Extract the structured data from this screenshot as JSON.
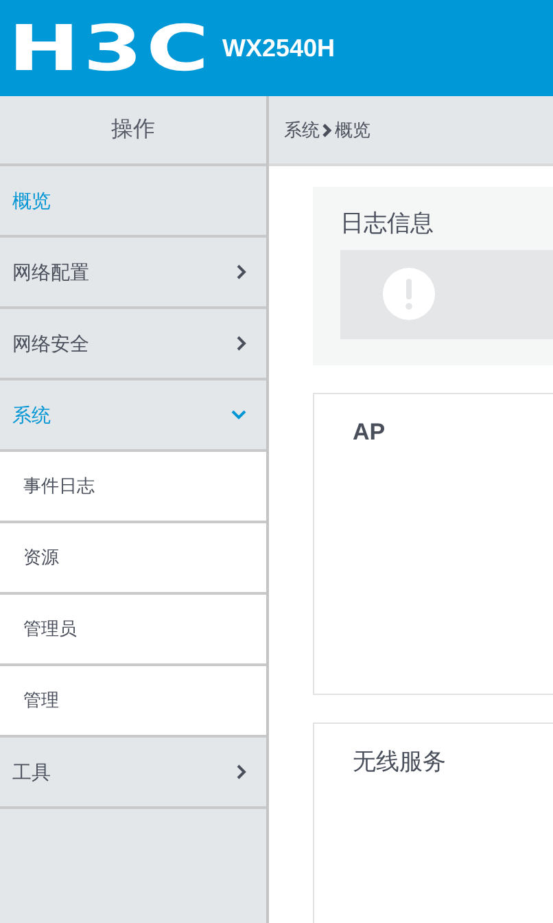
{
  "header": {
    "logo": "H3C",
    "model": "WX2540H"
  },
  "sidebar": {
    "title": "操作",
    "items": [
      {
        "kind": "link",
        "label": "概览",
        "selected": true
      },
      {
        "kind": "group",
        "label": "网络配置",
        "selected": false,
        "expanded": false
      },
      {
        "kind": "group",
        "label": "网络安全",
        "selected": false,
        "expanded": false
      },
      {
        "kind": "group",
        "label": "系统",
        "selected": true,
        "expanded": true,
        "children": [
          {
            "label": "事件日志",
            "selected": false
          },
          {
            "label": "资源",
            "selected": false
          },
          {
            "label": "管理员",
            "selected": false
          },
          {
            "label": "管理",
            "selected": false
          }
        ]
      },
      {
        "kind": "group",
        "label": "工具",
        "selected": false,
        "expanded": false
      }
    ]
  },
  "breadcrumb": [
    "系统",
    "概览"
  ],
  "cards": [
    {
      "kind": "alert",
      "title": "日志信息"
    },
    {
      "kind": "panel",
      "title": "AP"
    },
    {
      "kind": "panel",
      "title": "无线服务"
    }
  ]
}
